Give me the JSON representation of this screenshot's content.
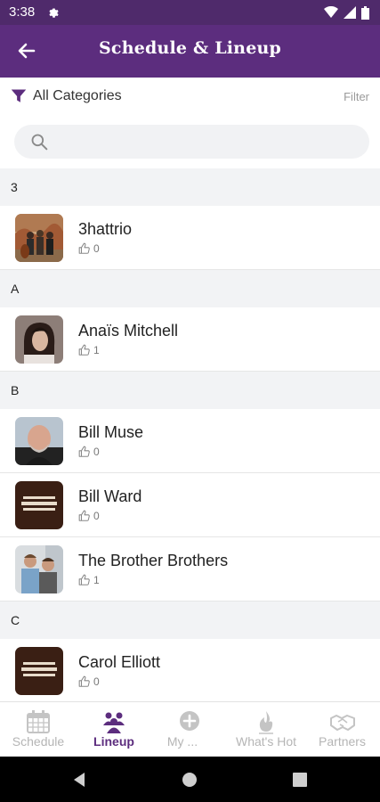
{
  "status_bar": {
    "time": "3:38"
  },
  "app_bar": {
    "title": "Schedule & Lineup"
  },
  "filter": {
    "category": "All Categories",
    "filter_label": "Filter"
  },
  "search": {
    "placeholder": ""
  },
  "sections": [
    {
      "letter": "3",
      "items": [
        {
          "name": "3hattrio",
          "likes": "0",
          "thumb": "photo-band-desert"
        }
      ]
    },
    {
      "letter": "A",
      "items": [
        {
          "name": "Anaïs Mitchell",
          "likes": "1",
          "thumb": "photo-woman-portrait"
        }
      ]
    },
    {
      "letter": "B",
      "items": [
        {
          "name": "Bill Muse",
          "likes": "0",
          "thumb": "photo-man-portrait"
        },
        {
          "name": "Bill Ward",
          "likes": "0",
          "thumb": "festival-logo"
        },
        {
          "name": "The Brother Brothers",
          "likes": "1",
          "thumb": "photo-duo"
        }
      ]
    },
    {
      "letter": "C",
      "items": [
        {
          "name": "Carol Elliott",
          "likes": "0",
          "thumb": "festival-logo"
        }
      ]
    }
  ],
  "bottom_nav": {
    "items": [
      {
        "label": "Schedule",
        "icon": "calendar-icon",
        "active": false
      },
      {
        "label": "Lineup",
        "icon": "people-icon",
        "active": true
      },
      {
        "label": "My ...",
        "icon": "plus-circle-icon",
        "active": false
      },
      {
        "label": "What's Hot",
        "icon": "flame-icon",
        "active": false
      },
      {
        "label": "Partners",
        "icon": "handshake-icon",
        "active": false
      }
    ]
  },
  "colors": {
    "primary": "#5c2d7e",
    "status_bar": "#4f2a6b",
    "section_bg": "#f2f3f5",
    "inactive": "#b5b5b5"
  }
}
